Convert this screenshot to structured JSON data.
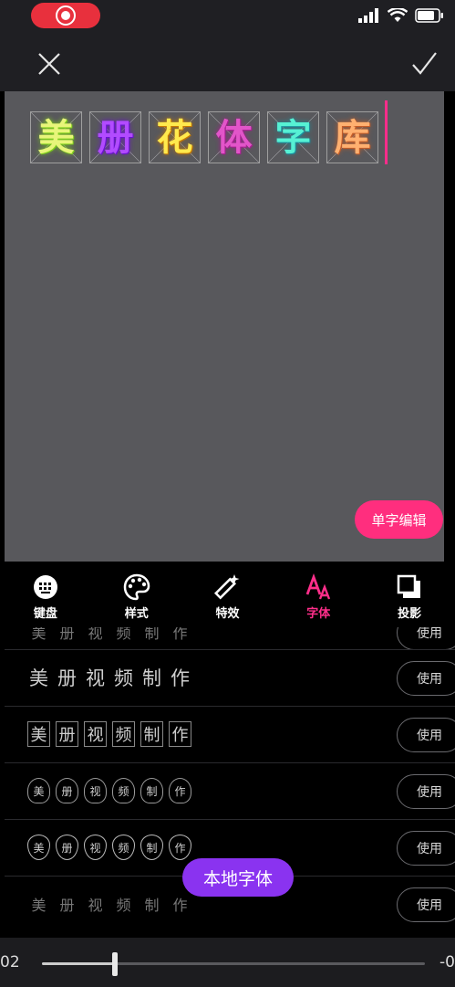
{
  "colors": {
    "accent_pink": "#ff2e7e",
    "local_purple": "#8a33f0",
    "record_red": "#e8303d"
  },
  "icons": {
    "record": "record-icon",
    "signal": "signal-icon",
    "wifi": "wifi-icon",
    "battery": "battery-icon",
    "close": "close-icon",
    "confirm": "checkmark-icon"
  },
  "editor": {
    "glyphs": [
      {
        "char": "美",
        "color": "#e8f57a",
        "shadow": "#7fd21a"
      },
      {
        "char": "册",
        "color": "#b24bff",
        "shadow": "#6a12d0"
      },
      {
        "char": "花",
        "color": "#ffe94d",
        "shadow": "#c97a00"
      },
      {
        "char": "体",
        "color": "#e255c9",
        "shadow": "#a61e90"
      },
      {
        "char": "字",
        "color": "#56f1d4",
        "shadow": "#1b8f9e"
      },
      {
        "char": "库",
        "color": "#ffb070",
        "shadow": "#c65d28"
      }
    ],
    "single_edit_label": "单字编辑"
  },
  "toolbar": {
    "items": [
      {
        "label": "键盘",
        "icon": "keyboard-icon",
        "active": false
      },
      {
        "label": "样式",
        "icon": "palette-icon",
        "active": false
      },
      {
        "label": "特效",
        "icon": "magic-wand-icon",
        "active": false
      },
      {
        "label": "字体",
        "icon": "font-icon",
        "active": true
      },
      {
        "label": "投影",
        "icon": "shadow-icon",
        "active": false
      }
    ]
  },
  "font_list": {
    "use_label": "使用",
    "sample_chars": [
      "美",
      "册",
      "视",
      "频",
      "制",
      "作"
    ],
    "rows": [
      {
        "style": "s-plain"
      },
      {
        "style": "s-box"
      },
      {
        "style": "s-bubble"
      },
      {
        "style": "s-heart"
      },
      {
        "style": "s-faded"
      }
    ]
  },
  "local_fonts_label": "本地字体",
  "player": {
    "time_left": "02",
    "time_right": "-0",
    "progress": 0.19
  }
}
